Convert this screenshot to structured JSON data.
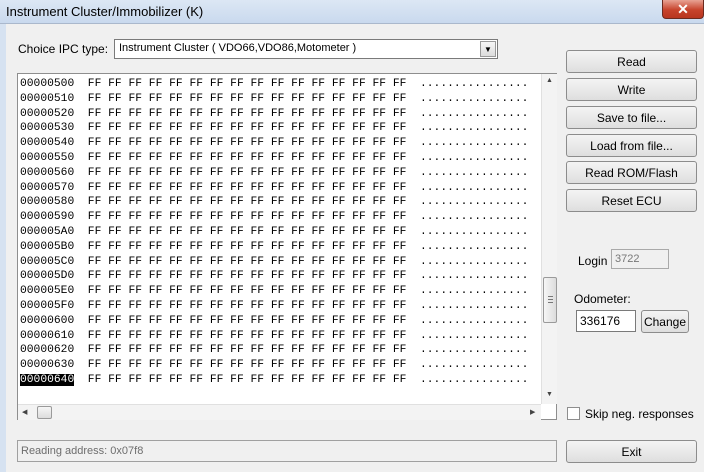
{
  "window": {
    "title": "Instrument Cluster/Immobilizer (K)",
    "close_glyph": "✕"
  },
  "ipc": {
    "label": "Choice IPC type:",
    "selected": "Instrument Cluster ( VDO66,VDO86,Motometer )"
  },
  "hex_rows": [
    {
      "addr": "00000500",
      "bytes": "FF FF FF FF FF FF FF FF FF FF FF FF FF FF FF FF",
      "ascii": "................"
    },
    {
      "addr": "00000510",
      "bytes": "FF FF FF FF FF FF FF FF FF FF FF FF FF FF FF FF",
      "ascii": "................"
    },
    {
      "addr": "00000520",
      "bytes": "FF FF FF FF FF FF FF FF FF FF FF FF FF FF FF FF",
      "ascii": "................"
    },
    {
      "addr": "00000530",
      "bytes": "FF FF FF FF FF FF FF FF FF FF FF FF FF FF FF FF",
      "ascii": "................"
    },
    {
      "addr": "00000540",
      "bytes": "FF FF FF FF FF FF FF FF FF FF FF FF FF FF FF FF",
      "ascii": "................"
    },
    {
      "addr": "00000550",
      "bytes": "FF FF FF FF FF FF FF FF FF FF FF FF FF FF FF FF",
      "ascii": "................"
    },
    {
      "addr": "00000560",
      "bytes": "FF FF FF FF FF FF FF FF FF FF FF FF FF FF FF FF",
      "ascii": "................"
    },
    {
      "addr": "00000570",
      "bytes": "FF FF FF FF FF FF FF FF FF FF FF FF FF FF FF FF",
      "ascii": "................"
    },
    {
      "addr": "00000580",
      "bytes": "FF FF FF FF FF FF FF FF FF FF FF FF FF FF FF FF",
      "ascii": "................"
    },
    {
      "addr": "00000590",
      "bytes": "FF FF FF FF FF FF FF FF FF FF FF FF FF FF FF FF",
      "ascii": "................"
    },
    {
      "addr": "000005A0",
      "bytes": "FF FF FF FF FF FF FF FF FF FF FF FF FF FF FF FF",
      "ascii": "................"
    },
    {
      "addr": "000005B0",
      "bytes": "FF FF FF FF FF FF FF FF FF FF FF FF FF FF FF FF",
      "ascii": "................"
    },
    {
      "addr": "000005C0",
      "bytes": "FF FF FF FF FF FF FF FF FF FF FF FF FF FF FF FF",
      "ascii": "................"
    },
    {
      "addr": "000005D0",
      "bytes": "FF FF FF FF FF FF FF FF FF FF FF FF FF FF FF FF",
      "ascii": "................"
    },
    {
      "addr": "000005E0",
      "bytes": "FF FF FF FF FF FF FF FF FF FF FF FF FF FF FF FF",
      "ascii": "................"
    },
    {
      "addr": "000005F0",
      "bytes": "FF FF FF FF FF FF FF FF FF FF FF FF FF FF FF FF",
      "ascii": "................"
    },
    {
      "addr": "00000600",
      "bytes": "FF FF FF FF FF FF FF FF FF FF FF FF FF FF FF FF",
      "ascii": "................"
    },
    {
      "addr": "00000610",
      "bytes": "FF FF FF FF FF FF FF FF FF FF FF FF FF FF FF FF",
      "ascii": "................"
    },
    {
      "addr": "00000620",
      "bytes": "FF FF FF FF FF FF FF FF FF FF FF FF FF FF FF FF",
      "ascii": "................"
    },
    {
      "addr": "00000630",
      "bytes": "FF FF FF FF FF FF FF FF FF FF FF FF FF FF FF FF",
      "ascii": "................"
    },
    {
      "addr": "00000640",
      "bytes": "FF FF FF FF FF FF FF FF FF FF FF FF FF FF FF FF",
      "ascii": "................",
      "selected": true
    }
  ],
  "buttons": {
    "read": "Read",
    "write": "Write",
    "save": "Save to file...",
    "load": "Load from file...",
    "read_rom": "Read ROM/Flash",
    "reset": "Reset ECU",
    "change": "Change",
    "exit": "Exit"
  },
  "login": {
    "label": "Login",
    "value": "3722"
  },
  "odometer": {
    "label": "Odometer:",
    "value": "336176"
  },
  "skip": {
    "label": "Skip neg. responses",
    "checked": false
  },
  "status": {
    "text": "Reading address: 0x07f8"
  },
  "icons": {
    "dropdown": "▼",
    "scroll_up": "▲",
    "scroll_down": "▼",
    "scroll_left": "◀",
    "scroll_right": "▶"
  }
}
